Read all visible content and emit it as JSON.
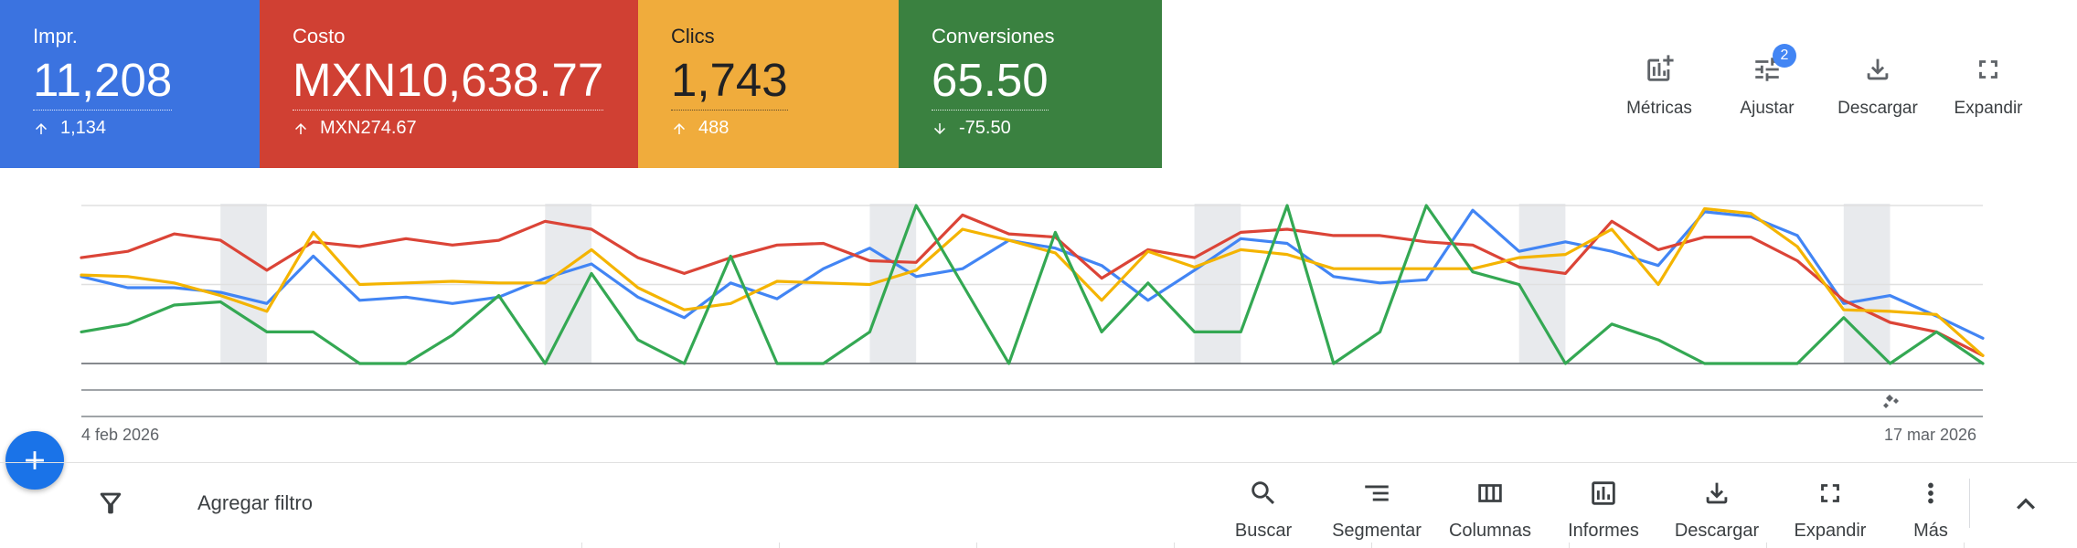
{
  "cards": [
    {
      "label": "Impr.",
      "value": "11,208",
      "delta": "1,134",
      "direction": "up",
      "color": "#3b73e0"
    },
    {
      "label": "Costo",
      "value": "MXN10,638.77",
      "delta": "MXN274.67",
      "direction": "up",
      "color": "#d04033"
    },
    {
      "label": "Clics",
      "value": "1,743",
      "delta": "488",
      "direction": "up",
      "color": "#f0ac3c"
    },
    {
      "label": "Conversiones",
      "value": "65.50",
      "delta": "-75.50",
      "direction": "down",
      "color": "#3a8140"
    }
  ],
  "top_tools": {
    "metrics": "Métricas",
    "adjust": "Ajustar",
    "adjust_badge": "2",
    "download": "Descargar",
    "expand": "Expandir"
  },
  "chart": {
    "start_date": "4 feb 2026",
    "end_date": "17 mar 2026"
  },
  "chart_data": {
    "type": "line",
    "x_start": "4 feb 2026",
    "x_end": "17 mar 2026",
    "shaded_periods": [
      [
        3,
        4
      ],
      [
        10,
        11
      ],
      [
        17,
        18
      ],
      [
        24,
        25
      ],
      [
        31,
        32
      ],
      [
        38,
        39
      ]
    ],
    "series": [
      {
        "color": "#4285f4",
        "values": [
          55,
          48,
          48,
          45,
          38,
          68,
          40,
          42,
          38,
          42,
          54,
          63,
          42,
          29,
          51,
          41,
          60,
          73,
          55,
          60,
          78,
          73,
          62,
          40,
          59,
          79,
          76,
          55,
          51,
          53,
          97,
          71,
          77,
          71,
          62,
          96,
          93,
          81,
          38,
          43,
          30,
          16
        ]
      },
      {
        "color": "#db4437",
        "values": [
          67,
          71,
          82,
          78,
          59,
          77,
          74,
          79,
          75,
          78,
          90,
          85,
          67,
          57,
          67,
          75,
          76,
          65,
          64,
          94,
          82,
          80,
          54,
          72,
          67,
          83,
          85,
          81,
          81,
          77,
          75,
          61,
          57,
          90,
          72,
          80,
          80,
          65,
          40,
          26,
          20,
          5
        ]
      },
      {
        "color": "#f4b400",
        "values": [
          56,
          55,
          51,
          43,
          33,
          83,
          50,
          51,
          52,
          51,
          51,
          72,
          48,
          34,
          38,
          52,
          51,
          50,
          59,
          85,
          78,
          70,
          40,
          71,
          61,
          72,
          69,
          60,
          60,
          60,
          60,
          67,
          69,
          85,
          50,
          98,
          95,
          74,
          34,
          33,
          31,
          5
        ]
      },
      {
        "color": "#34a853",
        "values": [
          20,
          25,
          37,
          39,
          20,
          20,
          0,
          0,
          18,
          43,
          0,
          57,
          15,
          0,
          68,
          0,
          0,
          20,
          100,
          50,
          0,
          83,
          20,
          51,
          20,
          20,
          100,
          0,
          20,
          100,
          58,
          50,
          0,
          25,
          15,
          0,
          0,
          0,
          29,
          0,
          20,
          0
        ]
      }
    ]
  },
  "bottom_toolbar": {
    "add_filter": "Agregar filtro",
    "search": "Buscar",
    "segment": "Segmentar",
    "columns": "Columnas",
    "reports": "Informes",
    "download": "Descargar",
    "expand": "Expandir",
    "more": "Más"
  }
}
